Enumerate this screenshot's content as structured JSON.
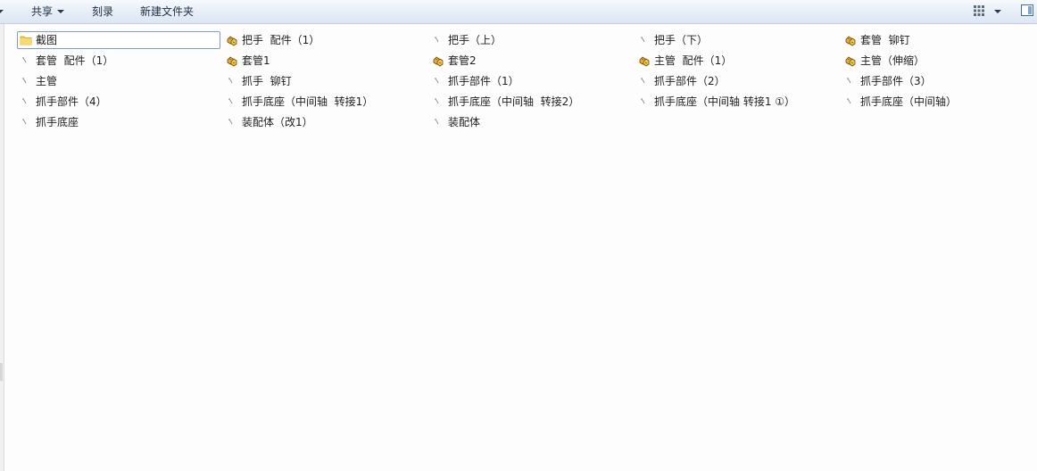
{
  "toolbar": {
    "share_label": "共享",
    "burn_label": "刻录",
    "new_folder_label": "新建文件夹",
    "view_icon": "view-grid-icon",
    "preview_pane_icon": "preview-pane-icon"
  },
  "colors": {
    "toolbar_bg": "#e6edf6",
    "assembly_icon": "#e8b22c",
    "folder_icon": "#f3c94f",
    "selection_border": "#7a9fc8"
  },
  "files": [
    {
      "name": "截图",
      "icon": "folder-icon",
      "selected": true
    },
    {
      "name": "把手  配件（1）",
      "icon": "assembly-icon"
    },
    {
      "name": "把手（上）",
      "icon": "part-icon"
    },
    {
      "name": "把手（下）",
      "icon": "part-icon"
    },
    {
      "name": "套管  铆钉",
      "icon": "assembly-icon"
    },
    {
      "name": "套管  配件（1）",
      "icon": "part-icon"
    },
    {
      "name": "套管1",
      "icon": "assembly-icon"
    },
    {
      "name": "套管2",
      "icon": "assembly-icon"
    },
    {
      "name": "主管  配件（1）",
      "icon": "assembly-icon"
    },
    {
      "name": "主管（伸缩）",
      "icon": "assembly-icon"
    },
    {
      "name": "主管",
      "icon": "part-icon"
    },
    {
      "name": "抓手  铆钉",
      "icon": "part-icon"
    },
    {
      "name": "抓手部件（1）",
      "icon": "part-icon"
    },
    {
      "name": "抓手部件（2）",
      "icon": "part-icon"
    },
    {
      "name": "抓手部件（3）",
      "icon": "part-icon"
    },
    {
      "name": "抓手部件（4）",
      "icon": "part-icon"
    },
    {
      "name": "抓手底座（中间轴  转接1）",
      "icon": "part-icon"
    },
    {
      "name": "抓手底座（中间轴  转接2）",
      "icon": "part-icon"
    },
    {
      "name": "抓手底座（中间轴 转接1 ①）",
      "icon": "part-icon"
    },
    {
      "name": "抓手底座（中间轴）",
      "icon": "part-icon"
    },
    {
      "name": "抓手底座",
      "icon": "part-icon"
    },
    {
      "name": "装配体（改1）",
      "icon": "part-icon"
    },
    {
      "name": "装配体",
      "icon": "part-icon"
    }
  ]
}
